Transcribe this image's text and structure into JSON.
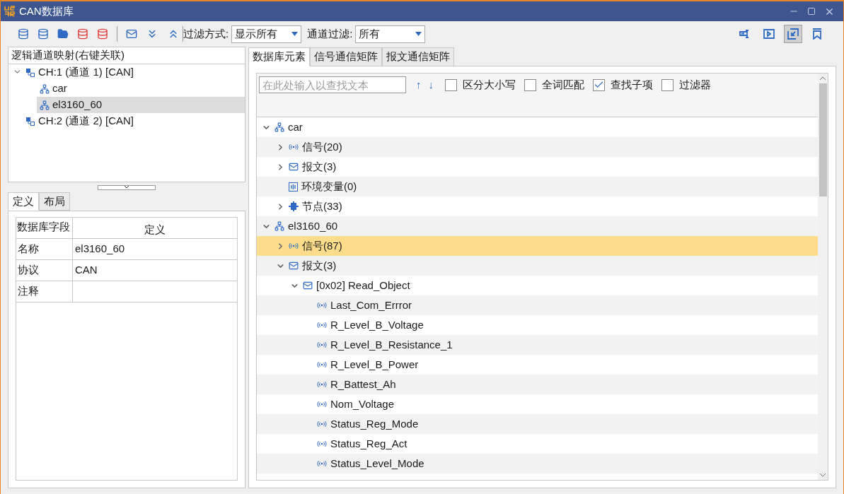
{
  "window": {
    "title": "CAN数据库"
  },
  "toolbar": {
    "filter_mode": {
      "label": "过滤方式:",
      "value": "显示所有"
    },
    "channel_filter": {
      "label": "通道过滤:",
      "value": "所有"
    },
    "right_tools": [
      {
        "selected": false
      },
      {
        "selected": false
      },
      {
        "selected": true
      },
      {
        "selected": false
      }
    ]
  },
  "channel_panel": {
    "title": "逻辑通道映射(右键关联)",
    "items": [
      {
        "label": "CH:1 (通道 1) [CAN]",
        "expanded": true,
        "selected": false,
        "children": [
          {
            "label": "car",
            "selected": false
          },
          {
            "label": "el3160_60",
            "selected": true
          }
        ]
      },
      {
        "label": "CH:2 (通道 2) [CAN]",
        "expanded": false,
        "selected": false
      }
    ]
  },
  "detail_tabs": [
    {
      "label": "定义",
      "selected": true
    },
    {
      "label": "布局",
      "selected": false
    }
  ],
  "detail_table": {
    "columns": [
      "数据库字段",
      "定义"
    ],
    "rows": [
      [
        "名称",
        "el3160_60"
      ],
      [
        "协议",
        "CAN"
      ],
      [
        "注释",
        ""
      ]
    ]
  },
  "main_tabs": [
    {
      "label": "数据库元素",
      "selected": true
    },
    {
      "label": "信号通信矩阵",
      "selected": false
    },
    {
      "label": "报文通信矩阵",
      "selected": false
    }
  ],
  "search": {
    "placeholder": "在此处输入以查找文本",
    "up": "↑",
    "down": "↓",
    "options": [
      {
        "label": "区分大小写",
        "checked": false
      },
      {
        "label": "全词匹配",
        "checked": false
      },
      {
        "label": "查找子项",
        "checked": true
      },
      {
        "label": "过滤器",
        "checked": false
      }
    ]
  },
  "tree": [
    {
      "kind": "database",
      "label": "car",
      "expanded": true,
      "selected": false,
      "children": [
        {
          "kind": "signals",
          "label": "信号(20)",
          "expanded": false,
          "selected": false
        },
        {
          "kind": "messages",
          "label": "报文(3)",
          "expanded": false,
          "selected": false
        },
        {
          "kind": "envvars",
          "label": "环境变量(0)",
          "selected": false
        },
        {
          "kind": "nodes",
          "label": "节点(33)",
          "expanded": false,
          "selected": false
        }
      ]
    },
    {
      "kind": "database",
      "label": "el3160_60",
      "expanded": true,
      "selected": false,
      "children": [
        {
          "kind": "signals",
          "label": "信号(87)",
          "expanded": false,
          "selected": true
        },
        {
          "kind": "messages",
          "label": "报文(3)",
          "expanded": true,
          "selected": false,
          "children": [
            {
              "kind": "message",
              "label": "[0x02] Read_Object",
              "expanded": true,
              "selected": false,
              "children": [
                {
                  "kind": "signal",
                  "label": "Last_Com_Errror",
                  "selected": false
                },
                {
                  "kind": "signal",
                  "label": "R_Level_B_Voltage",
                  "selected": false
                },
                {
                  "kind": "signal",
                  "label": "R_Level_B_Resistance_1",
                  "selected": false
                },
                {
                  "kind": "signal",
                  "label": "R_Level_B_Power",
                  "selected": false
                },
                {
                  "kind": "signal",
                  "label": "R_Battest_Ah",
                  "selected": false
                },
                {
                  "kind": "signal",
                  "label": "Nom_Voltage",
                  "selected": false
                },
                {
                  "kind": "signal",
                  "label": "Status_Reg_Mode",
                  "selected": false
                },
                {
                  "kind": "signal",
                  "label": "Status_Reg_Act",
                  "selected": false
                },
                {
                  "kind": "signal",
                  "label": "Status_Level_Mode",
                  "selected": false
                }
              ]
            }
          ]
        }
      ]
    }
  ]
}
